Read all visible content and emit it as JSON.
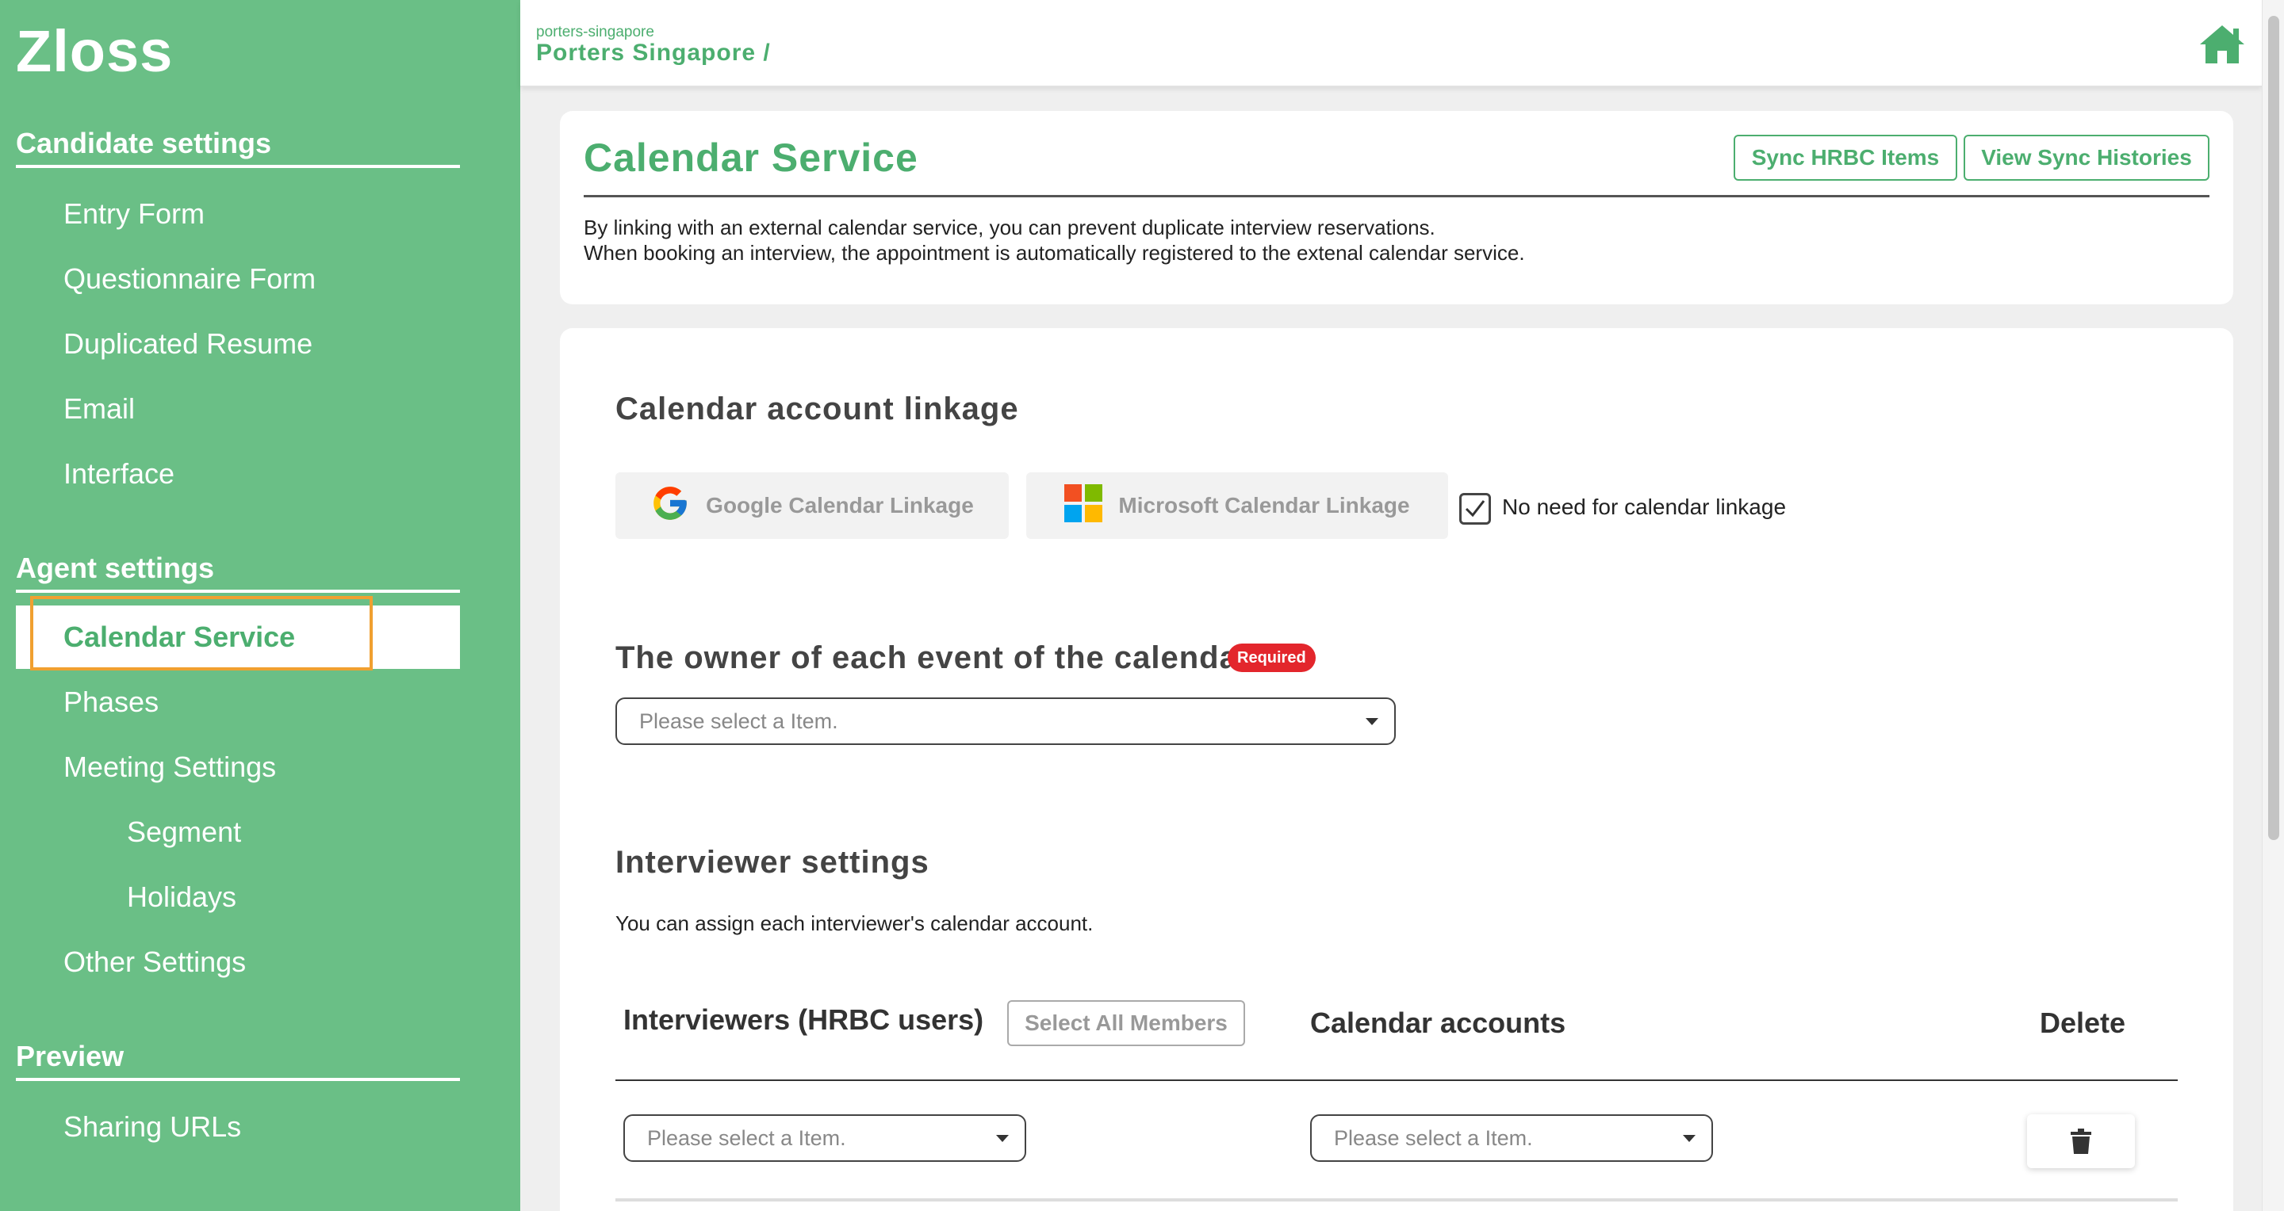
{
  "sidebar": {
    "logo": "Zloss",
    "candidate_settings": {
      "title": "Candidate settings",
      "items": [
        "Entry Form",
        "Questionnaire Form",
        "Duplicated Resume",
        "Email",
        "Interface"
      ]
    },
    "agent_settings": {
      "title": "Agent settings",
      "items": [
        "Calendar Service",
        "Phases",
        "Meeting Settings",
        "Segment",
        "Holidays",
        "Other Settings"
      ]
    },
    "preview": {
      "title": "Preview",
      "items": [
        "Sharing URLs"
      ]
    }
  },
  "header": {
    "org_id": "porters-singapore",
    "org_name": "Porters Singapore /",
    "home_icon": "home-icon"
  },
  "info_card": {
    "title": "Calendar Service",
    "sync_button": "Sync HRBC Items",
    "histories_button": "View Sync Histories",
    "desc_line1": "By linking with an external calendar service, you can prevent duplicate interview reservations.",
    "desc_line2": "When booking an interview, the appointment is automatically registered to the extenal calendar service."
  },
  "linkage": {
    "title": "Calendar account linkage",
    "google_button": "Google Calendar Linkage",
    "microsoft_button": "Microsoft Calendar Linkage",
    "no_need_label": "No need for calendar linkage",
    "no_need_checked": true
  },
  "owner": {
    "title": "The owner of each event of the calendar",
    "required_badge": "Required",
    "placeholder": "Please select a Item."
  },
  "interviewers": {
    "title": "Interviewer settings",
    "note": "You can assign each interviewer's calendar account.",
    "col_interviewers": "Interviewers (HRBC users)",
    "select_all": "Select All Members",
    "col_accounts": "Calendar accounts",
    "col_delete": "Delete",
    "row": {
      "interviewer_placeholder": "Please select a Item.",
      "account_placeholder": "Please select a Item."
    }
  },
  "colors": {
    "brand_green": "#6abf86",
    "accent_green": "#4cae6f",
    "required_red": "#e3262c",
    "active_outline": "#f0a030"
  }
}
